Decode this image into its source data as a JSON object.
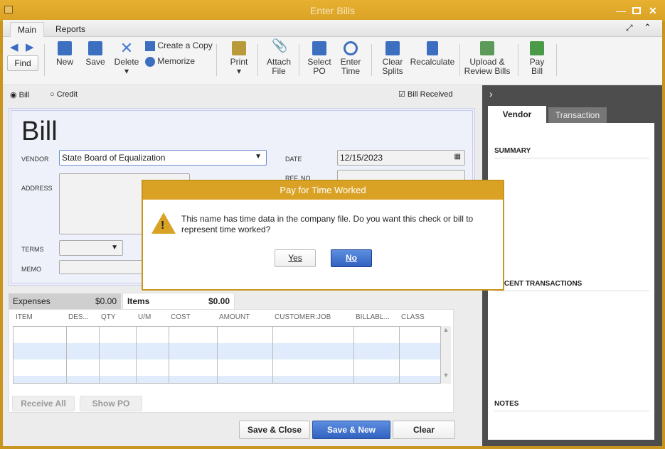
{
  "window": {
    "title": "Enter Bills"
  },
  "tabs": [
    "Main",
    "Reports"
  ],
  "toolbar": {
    "find": "Find",
    "new": "New",
    "save": "Save",
    "delete": "Delete",
    "create_copy": "Create a Copy",
    "memorize": "Memorize",
    "print": "Print",
    "attach_1": "Attach",
    "attach_2": "File",
    "select_1": "Select",
    "select_2": "PO",
    "enter_1": "Enter",
    "enter_2": "Time",
    "clear_1": "Clear",
    "clear_2": "Splits",
    "recalculate": "Recalculate",
    "upload_1": "Upload &",
    "upload_2": "Review Bills",
    "pay_1": "Pay",
    "pay_2": "Bill"
  },
  "form": {
    "bill_radio": "Bill",
    "credit_radio": "Credit",
    "bill_received": "Bill Received",
    "heading": "Bill",
    "vendor_label": "VENDOR",
    "vendor": "State Board of Equalization",
    "date_label": "DATE",
    "date": "12/15/2023",
    "ref_label": "REF. NO.",
    "address_label": "ADDRESS",
    "terms_label": "TERMS",
    "memo_label": "MEMO"
  },
  "detail": {
    "expenses_tab": "Expenses",
    "expenses_amt": "$0.00",
    "items_tab": "Items",
    "items_amt": "$0.00",
    "columns": [
      "ITEM",
      "DES...",
      "QTY",
      "U/M",
      "COST",
      "AMOUNT",
      "CUSTOMER:JOB",
      "BILLABL...",
      "CLASS"
    ],
    "receive_all": "Receive All",
    "show_po": "Show PO"
  },
  "buttons": {
    "save_close": "Save & Close",
    "save_new": "Save & New",
    "clear": "Clear"
  },
  "panel": {
    "vendor_tab": "Vendor",
    "transaction_tab": "Transaction",
    "summary": "SUMMARY",
    "recent": "RECENT TRANSACTIONS",
    "notes": "NOTES"
  },
  "dialog": {
    "title": "Pay for Time Worked",
    "message": "This name has time data in the company file. Do you want this check or bill to represent time worked?",
    "yes": "Yes",
    "no": "No"
  }
}
